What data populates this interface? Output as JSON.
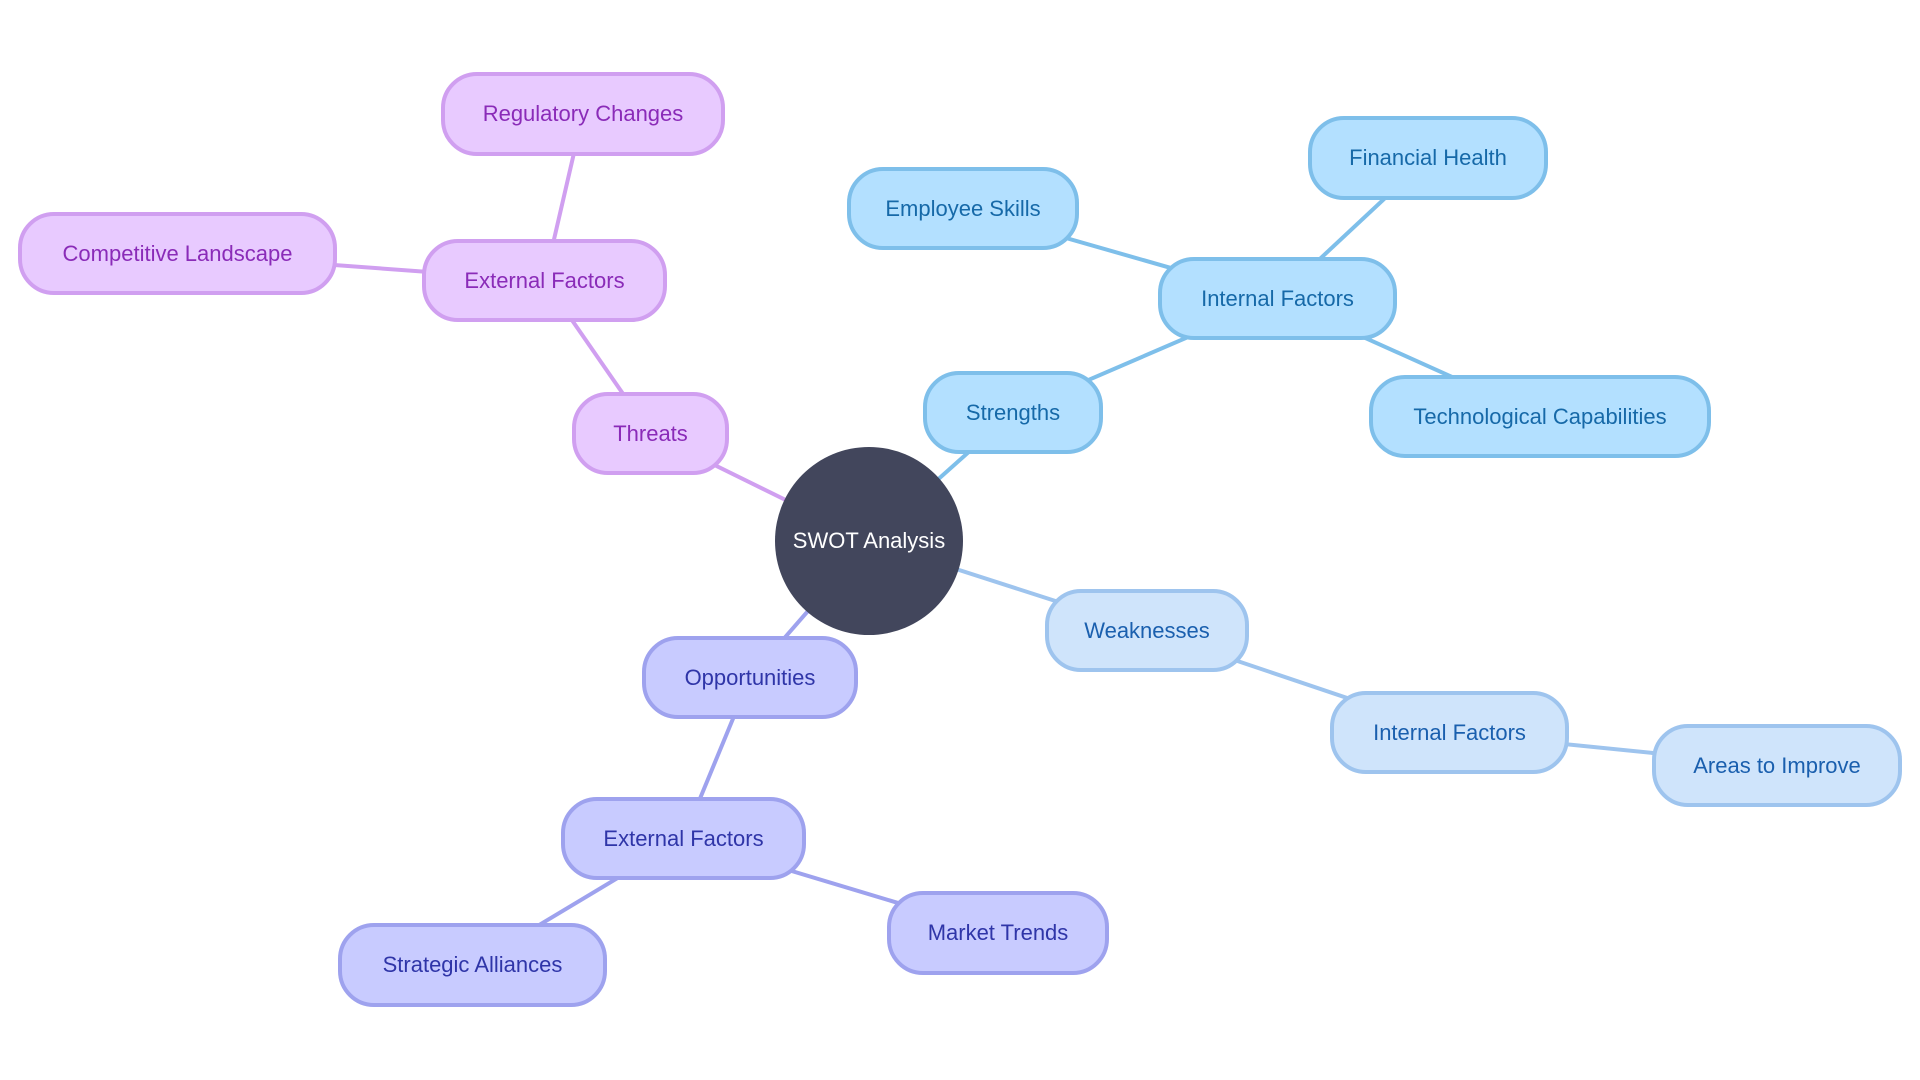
{
  "diagram": {
    "type": "mindmap",
    "root": {
      "id": "root",
      "label": "SWOT Analysis"
    },
    "colors": {
      "root_fill": "#42465c",
      "root_text": "#ffffff",
      "threats": {
        "fill": "#e8caff",
        "border": "#d09ff0",
        "text": "#8a2bb8",
        "edge": "#d09ff0"
      },
      "opportunities": {
        "fill": "#c8cbff",
        "border": "#9ea2ee",
        "text": "#2f35a8",
        "edge": "#9ea2ee"
      },
      "strengths": {
        "fill": "#b3e0ff",
        "border": "#7ebfea",
        "text": "#1669a8",
        "edge": "#7ebfea"
      },
      "weaknesses": {
        "fill": "#cfe4fb",
        "border": "#9ec4ee",
        "text": "#1a5fae",
        "edge": "#9ec4ee"
      }
    },
    "nodes": {
      "threats": {
        "label": "Threats",
        "branch": "threats"
      },
      "threats_ext": {
        "label": "External Factors",
        "branch": "threats"
      },
      "regulatory": {
        "label": "Regulatory Changes",
        "branch": "threats"
      },
      "competitive": {
        "label": "Competitive Landscape",
        "branch": "threats"
      },
      "strengths": {
        "label": "Strengths",
        "branch": "strengths"
      },
      "strengths_int": {
        "label": "Internal Factors",
        "branch": "strengths"
      },
      "employee": {
        "label": "Employee Skills",
        "branch": "strengths"
      },
      "financial": {
        "label": "Financial Health",
        "branch": "strengths"
      },
      "technological": {
        "label": "Technological Capabilities",
        "branch": "strengths"
      },
      "weaknesses": {
        "label": "Weaknesses",
        "branch": "weaknesses"
      },
      "weaknesses_int": {
        "label": "Internal Factors",
        "branch": "weaknesses"
      },
      "areas": {
        "label": "Areas to Improve",
        "branch": "weaknesses"
      },
      "opportunities": {
        "label": "Opportunities",
        "branch": "opportunities"
      },
      "opportunities_ext": {
        "label": "External Factors",
        "branch": "opportunities"
      },
      "market": {
        "label": "Market Trends",
        "branch": "opportunities"
      },
      "alliances": {
        "label": "Strategic Alliances",
        "branch": "opportunities"
      }
    },
    "edges": [
      [
        "root",
        "threats"
      ],
      [
        "threats",
        "threats_ext"
      ],
      [
        "threats_ext",
        "regulatory"
      ],
      [
        "threats_ext",
        "competitive"
      ],
      [
        "root",
        "strengths"
      ],
      [
        "strengths",
        "strengths_int"
      ],
      [
        "strengths_int",
        "employee"
      ],
      [
        "strengths_int",
        "financial"
      ],
      [
        "strengths_int",
        "technological"
      ],
      [
        "root",
        "weaknesses"
      ],
      [
        "weaknesses",
        "weaknesses_int"
      ],
      [
        "weaknesses_int",
        "areas"
      ],
      [
        "root",
        "opportunities"
      ],
      [
        "opportunities",
        "opportunities_ext"
      ],
      [
        "opportunities_ext",
        "market"
      ],
      [
        "opportunities_ext",
        "alliances"
      ]
    ]
  }
}
